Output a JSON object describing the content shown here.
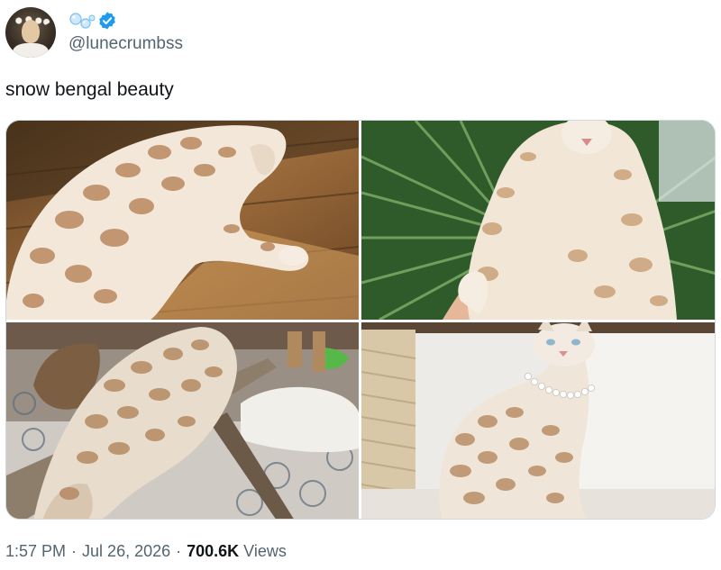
{
  "author": {
    "handle": "@lunecrumbss",
    "name_icon": "bubbles-icon",
    "verified_icon": "verified-badge-icon",
    "verified_color": "#1d9bf0"
  },
  "tweet": {
    "text": "snow bengal beauty"
  },
  "media": [
    {
      "subject": "cat-lying-on-wooden-floor"
    },
    {
      "subject": "cat-held-by-hand-in-front-of-palm-leaves"
    },
    {
      "subject": "cat-on-wooden-bench-from-behind"
    },
    {
      "subject": "cat-with-pearl-necklace-sitting-by-scratching-post"
    }
  ],
  "meta": {
    "time": "1:57 PM",
    "separator": "·",
    "date": "Jul 26, 2026",
    "views_count": "700.6K",
    "views_label": "Views"
  },
  "colors": {
    "text": "#0f1419",
    "secondary_text": "#536471",
    "border": "#cfd9de"
  }
}
